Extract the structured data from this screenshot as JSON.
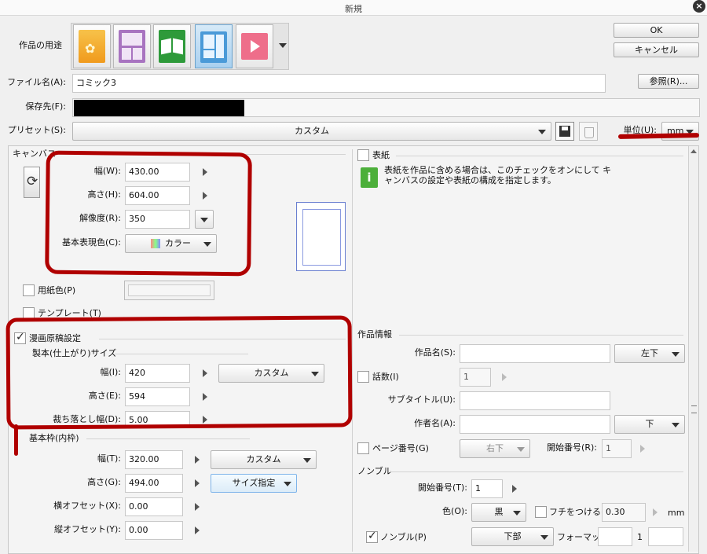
{
  "window": {
    "title": "新規",
    "close": "×"
  },
  "buttons": {
    "ok": "OK",
    "cancel": "キャンセル",
    "browse": "参照(R)..."
  },
  "purpose": {
    "label": "作品の用途",
    "icons": [
      "illustration-icon",
      "webtoon-icon",
      "comic-icon",
      "all-comic-settings-icon",
      "animation-icon"
    ]
  },
  "file_name": {
    "label": "ファイル名(A):",
    "value": "コミック3"
  },
  "save_to": {
    "label": "保存先(F):",
    "value": ""
  },
  "preset": {
    "label": "プリセット(S):",
    "value": "カスタム"
  },
  "unit": {
    "label": "単位(U):",
    "value": "mm"
  },
  "canvas": {
    "section": "キャンバス",
    "width": {
      "label": "幅(W):",
      "value": "430.00"
    },
    "height": {
      "label": "高さ(H):",
      "value": "604.00"
    },
    "resolution": {
      "label": "解像度(R):",
      "value": "350"
    },
    "color": {
      "label": "基本表現色(C):",
      "value": "カラー"
    },
    "paper_color": {
      "label": "用紙色(P)"
    },
    "template": {
      "label": "テンプレート(T)"
    }
  },
  "manga": {
    "section": "漫画原稿設定",
    "finish": {
      "section": "製本(仕上がり)サイズ",
      "width": {
        "label": "幅(I):",
        "value": "420"
      },
      "height": {
        "label": "高さ(E):",
        "value": "594"
      },
      "bleed": {
        "label": "裁ち落とし幅(D):",
        "value": "5.00"
      },
      "size_combo": "カスタム"
    },
    "basic_frame": {
      "section": "基本枠(内枠)",
      "width": {
        "label": "幅(T):",
        "value": "320.00"
      },
      "height": {
        "label": "高さ(G):",
        "value": "494.00"
      },
      "x_offset": {
        "label": "横オフセット(X):",
        "value": "0.00"
      },
      "y_offset": {
        "label": "縦オフセット(Y):",
        "value": "0.00"
      },
      "size_combo": "カスタム",
      "size_spec": "サイズ指定"
    }
  },
  "cover": {
    "label": "表紙",
    "info": "表紙を作品に含める場合は、このチェックをオンにして キャンバスの設定や表紙の構成を指定します。"
  },
  "work_info": {
    "section": "作品情報",
    "title": {
      "label": "作品名(S):",
      "value": "",
      "pos": "左下"
    },
    "episode": {
      "label": "話数(I)",
      "value": "1"
    },
    "subtitle": {
      "label": "サブタイトル(U):",
      "value": ""
    },
    "author": {
      "label": "作者名(A):",
      "value": "",
      "pos": "下"
    },
    "page_number": {
      "label": "ページ番号(G)",
      "pos": "右下",
      "start_label": "開始番号(R):",
      "start": "1"
    }
  },
  "nombre": {
    "section": "ノンブル",
    "start": {
      "label": "開始番号(T):",
      "value": "1"
    },
    "color": {
      "label": "色(O):",
      "value": "黒"
    },
    "border": {
      "label": "フチをつける(E)",
      "value": "0.30",
      "unit": "mm"
    },
    "nombre": {
      "label": "ノンブル(P)",
      "pos": "下部",
      "format_label": "フォーマット:",
      "format_value": "1"
    }
  }
}
